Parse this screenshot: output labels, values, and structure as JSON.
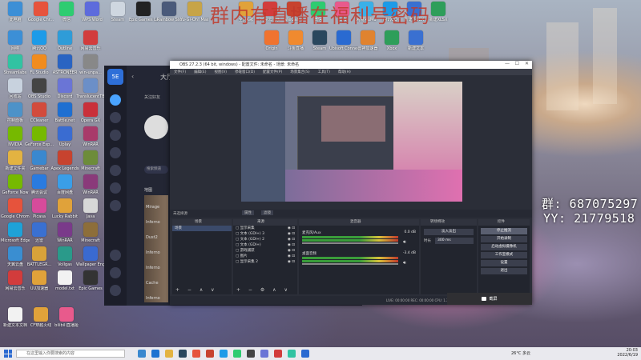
{
  "banner": {
    "text": "群内有直播在福利号密码"
  },
  "contact": {
    "qun": "群: 687075297",
    "yy": "YY: 21779518"
  },
  "desktop_icons": [
    {
      "label": "此电脑",
      "color": "#3c8fd6"
    },
    {
      "label": "Google Chr...",
      "color": "#e6533c"
    },
    {
      "label": "微信",
      "color": "#2ecc71"
    },
    {
      "label": "WPS Word",
      "color": "#5d6bdc"
    },
    {
      "label": "Steam",
      "color": "#cfd7e0"
    },
    {
      "label": "Epic Games Launcher",
      "color": "#222"
    },
    {
      "label": "Rainbow Six",
      "color": "#4a5a7a"
    },
    {
      "label": "Yu-Gi-Oh! Master Duel",
      "color": "#c7a447"
    },
    {
      "label": "网络",
      "color": "#3c8fd6"
    },
    {
      "label": "腾讯QQ",
      "color": "#1d9be8"
    },
    {
      "label": "Outline",
      "color": "#2f9cd8"
    },
    {
      "label": "网易云音乐",
      "color": "#d23c3c"
    },
    {
      "label": "Streamlabs",
      "color": "#31c3a2"
    },
    {
      "label": "FL Studio",
      "color": "#f18c1e"
    },
    {
      "label": "ASTRONEER",
      "color": "#2a64c2"
    },
    {
      "label": "win-unpa...",
      "color": "#888"
    },
    {
      "label": "回收站",
      "color": "#c8d2de"
    },
    {
      "label": "OBS Studio",
      "color": "#444"
    },
    {
      "label": "Discord",
      "color": "#6a75d6"
    },
    {
      "label": "TranslucentTB",
      "color": "#6b8fc8"
    },
    {
      "label": "控制面板",
      "color": "#4d92c8"
    },
    {
      "label": "CCleaner",
      "color": "#d24b3c"
    },
    {
      "label": "Battle.net",
      "color": "#1f6fd1"
    },
    {
      "label": "Opera GX",
      "color": "#c9303a"
    },
    {
      "label": "NVIDIA",
      "color": "#76b900"
    },
    {
      "label": "GeForce Exp...",
      "color": "#76b900"
    },
    {
      "label": "Uplay",
      "color": "#3a6cd1"
    },
    {
      "label": "WinRAR",
      "color": "#a83a6a"
    },
    {
      "label": "新建文件夹",
      "color": "#e3b341"
    },
    {
      "label": "Gamebar",
      "color": "#3a88cf"
    },
    {
      "label": "Apex Legends",
      "color": "#c7432f"
    },
    {
      "label": "Minecraft",
      "color": "#6d8c3a"
    },
    {
      "label": "GeForce Now",
      "color": "#76b900"
    },
    {
      "label": "腾讯会议",
      "color": "#2a7be0"
    },
    {
      "label": "百度网盘",
      "color": "#3a9ee8"
    },
    {
      "label": "WinRAR",
      "color": "#8a3a7a"
    },
    {
      "label": "Google Chrome",
      "color": "#e6533c"
    },
    {
      "label": "Picasa",
      "color": "#d64b9b"
    },
    {
      "label": "Lucky Rabbit",
      "color": "#e0a23a"
    },
    {
      "label": "Java",
      "color": "#d7d7d7"
    },
    {
      "label": "Microsoft Edge",
      "color": "#1ea2d8"
    },
    {
      "label": "迅雷",
      "color": "#3a70d1"
    },
    {
      "label": "WinRAR",
      "color": "#7a3a8a"
    },
    {
      "label": "Minecraft",
      "color": "#8d6e3a"
    },
    {
      "label": "天翼云盘",
      "color": "#3a8ed1"
    },
    {
      "label": "BATTLEGR...",
      "color": "#d8a23a"
    },
    {
      "label": "Vollgas",
      "color": "#2a9a8a"
    },
    {
      "label": "Wallpaper Engine",
      "color": "#3a6ad1"
    },
    {
      "label": "网易云音乐",
      "color": "#d23c3c"
    },
    {
      "label": "UU加速器",
      "color": "#e0a23a"
    },
    {
      "label": "model.txt",
      "color": "#f2f2f2"
    },
    {
      "label": "Epic Games",
      "color": "#333"
    },
    {
      "label": "新建文本文档",
      "color": "#f2f2f2"
    },
    {
      "label": "CF穿越火线",
      "color": "#e0a23a"
    },
    {
      "label": "bilibili直播姬",
      "color": "#e85a8c"
    }
  ],
  "top_icons": [
    {
      "label": "全民K歌",
      "color": "#e0a23a"
    },
    {
      "label": "网易云音乐",
      "color": "#d23c3c"
    },
    {
      "label": "WeGame",
      "color": "#c7432f"
    },
    {
      "label": "微信",
      "color": "#2ecc71"
    },
    {
      "label": "YoYo",
      "color": "#e85a8c"
    },
    {
      "label": "网易MuMu",
      "color": "#3ab0e8"
    },
    {
      "label": "腾讯QQ",
      "color": "#1d9be8"
    },
    {
      "label": "新建DOCX",
      "color": "#3a70d1"
    },
    {
      "label": "新建XLSX",
      "color": "#2e9e5a"
    },
    {
      "label": "Origin",
      "color": "#f0732f"
    },
    {
      "label": "斗鱼直播",
      "color": "#f08a2f"
    },
    {
      "label": "Steam",
      "color": "#2a475e"
    },
    {
      "label": "Ubisoft Connect",
      "color": "#2a6ad1"
    },
    {
      "label": "雷神加速器",
      "color": "#e0832f"
    },
    {
      "label": "Xbox",
      "color": "#2e9e5a"
    },
    {
      "label": "新建文本",
      "color": "#3a70d1"
    }
  ],
  "app": {
    "title": "大厅",
    "friends_tab": "关注好友",
    "search_placeholder": "搜索频道",
    "section": "地图",
    "strips": [
      "Mirage",
      "Inferno",
      "Dust2",
      "Inferno",
      "Inferno",
      "Cache",
      "Inferno"
    ]
  },
  "obs": {
    "title": "OBS 27.2.3 (64 bit, windows) - 配置文件: 未命名 - 场景: 未命名",
    "menu": [
      "文件(F)",
      "编辑(E)",
      "视图(V)",
      "停靠窗口(D)",
      "配置文件(P)",
      "场景集合(S)",
      "工具(T)",
      "帮助(H)"
    ],
    "scene_bar": {
      "source_label": "未选择源",
      "props": "属性",
      "filters": "滤镜"
    },
    "panel_titles": [
      "场景",
      "来源",
      "混音器",
      "转场特效",
      "控件"
    ],
    "scenes": [
      "场景"
    ],
    "sources": [
      "显示采集",
      "文本 (GDI+) 3",
      "文本 (GDI+) 2",
      "文本 (GDI+)",
      "游戏捕获",
      "图片",
      "显示采集 2"
    ],
    "mixer": [
      {
        "name": "麦克风/Aux",
        "db": "0.0 dB"
      },
      {
        "name": "桌面音频",
        "db": "-3.4 dB"
      }
    ],
    "transitions": {
      "type": "淡入淡出",
      "duration_label": "时长",
      "duration": "300 ms"
    },
    "controls": [
      "停止推流",
      "开始录制",
      "启动虚拟摄像机",
      "工作室模式",
      "设置",
      "退出"
    ],
    "status": "LIVE: 00:00:00   REC: 00:00:00   CPU: 1.3%, 30.00 fps",
    "tip": "截屏"
  },
  "taskbar": {
    "search_placeholder": "在这里输入你要搜索的内容",
    "weather": "26°C 多云",
    "time": "20:03",
    "date": "2022/6/19"
  }
}
